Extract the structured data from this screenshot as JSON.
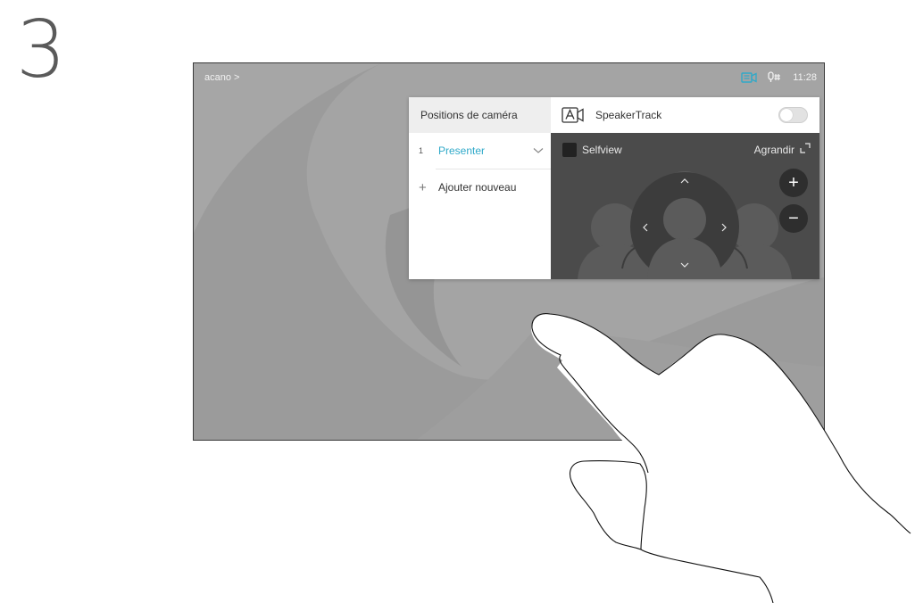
{
  "step": "3",
  "topbar": {
    "breadcrumb": "acano >",
    "time": "11:28",
    "camera_icon": "camera-status-icon",
    "mic_icon": "microphone-icon",
    "accent_color": "#2fa9c9"
  },
  "panel": {
    "left_title": "Positions de caméra",
    "positions": [
      {
        "number": "1",
        "name": "Presenter",
        "icon": "chevron-down-icon"
      }
    ],
    "add_label": "Ajouter nouveau",
    "speakertrack_label": "SpeakerTrack",
    "speakertrack_enabled": false,
    "selfview_label": "Selfview",
    "expand_label": "Agrandir",
    "zoom_in": "+",
    "zoom_out": "−"
  }
}
